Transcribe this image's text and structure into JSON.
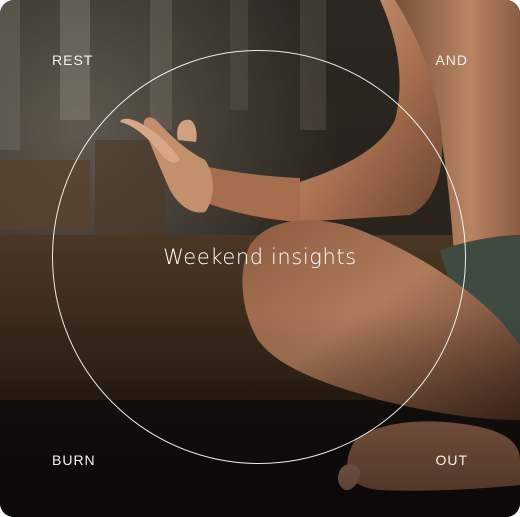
{
  "corner_labels": {
    "top_left": "REST",
    "top_right": "AND",
    "bottom_left": "BURN",
    "bottom_right": "OUT"
  },
  "headline": "Weekend insights",
  "colors": {
    "text": "#ffffff",
    "ring": "#ffffff",
    "background_dark": "#1e1a16",
    "skin_tone": "#b98161",
    "shorts": "#3f4a41"
  }
}
